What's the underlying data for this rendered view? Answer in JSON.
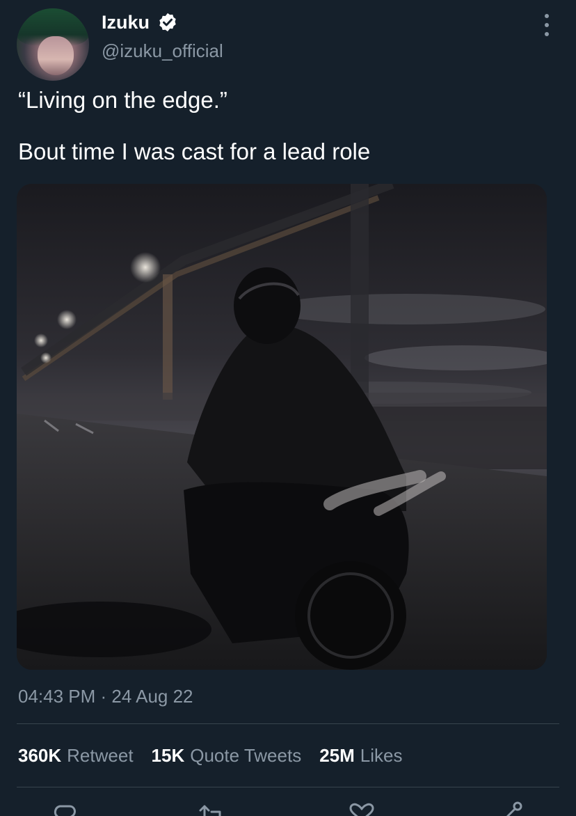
{
  "author": {
    "display_name": "Izuku",
    "handle": "@izuku_official",
    "verified": true,
    "avatar_icon": "profile-avatar"
  },
  "tweet": {
    "lines": [
      "“Living on the edge.”",
      "Bout time I was cast for a lead role"
    ],
    "media_icon": "photo-motorcycle-rider-on-bridge",
    "timestamp": "04:43 PM · 24 Aug 22"
  },
  "stats": {
    "retweets": {
      "count": "360K",
      "label": "Retweet"
    },
    "quotes": {
      "count": "15K",
      "label": "Quote Tweets"
    },
    "likes": {
      "count": "25M",
      "label": "Likes"
    }
  },
  "actions": [
    "reply-icon",
    "retweet-icon",
    "like-icon",
    "share-icon"
  ],
  "colors": {
    "background": "#15202b",
    "text_primary": "#ffffff",
    "text_secondary": "#8b98a5",
    "divider": "#38444d"
  }
}
